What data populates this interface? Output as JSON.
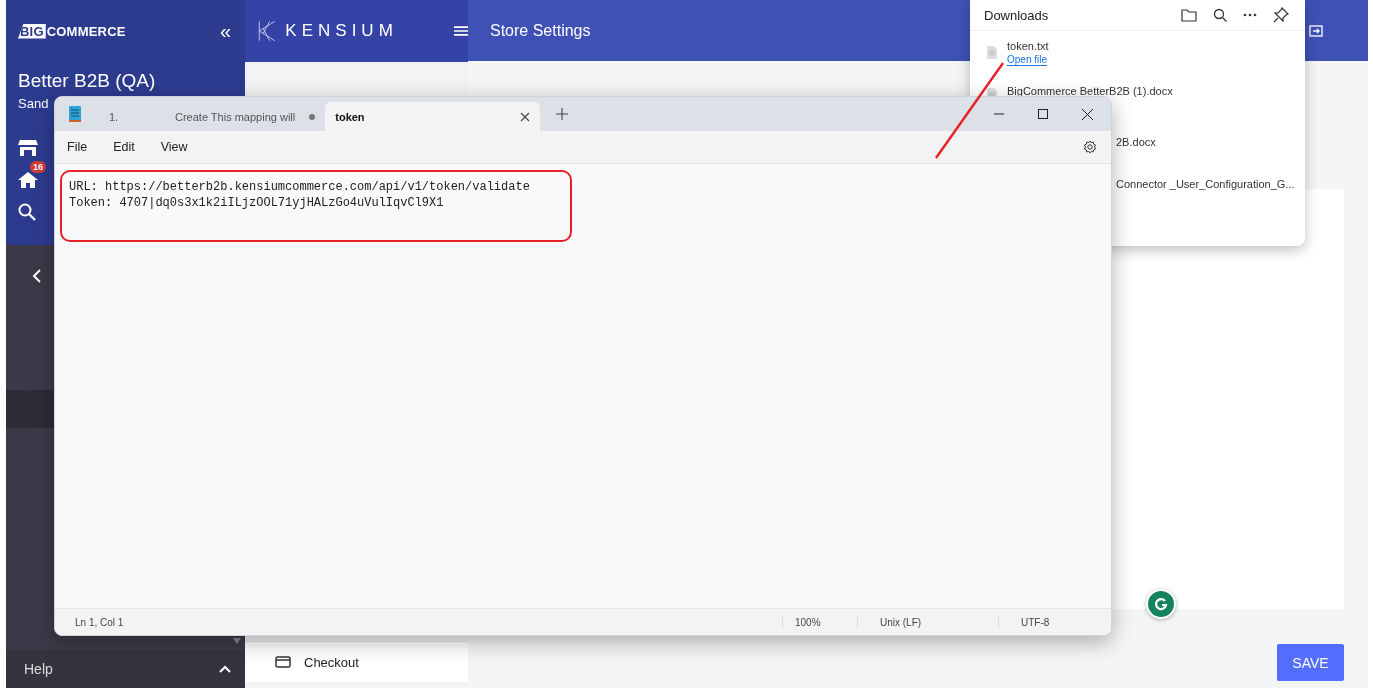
{
  "sidebar": {
    "logo_mark": "BIG",
    "logo_text": "COMMERCE",
    "collapse": "«",
    "store_name": "Better B2B (QA)",
    "store_sub": "Sand",
    "notification_count": "16",
    "help": "Help"
  },
  "kensium": {
    "logo": "KENSIUM",
    "nav": [
      {
        "label": "Checkout"
      }
    ]
  },
  "header": {
    "title": "Store Settings"
  },
  "save": "SAVE",
  "notepad": {
    "tabs": [
      {
        "label": "1.",
        "selected": false,
        "modified": false
      },
      {
        "label": "Create This mapping will",
        "selected": false,
        "modified": true
      },
      {
        "label": "token",
        "selected": true,
        "modified": false
      }
    ],
    "menu": [
      "File",
      "Edit",
      "View"
    ],
    "lines": [
      "URL: https://betterb2b.kensiumcommerce.com/api/v1/token/validate",
      "Token: 4707|dq0s3x1k2iILjzOOL71yjHALzGo4uVulIqvCl9X1"
    ],
    "status": [
      "Ln 1, Col 1",
      "100%",
      "Unix (LF)",
      "UTF-8"
    ]
  },
  "downloads": {
    "title": "Downloads",
    "items": [
      {
        "kind": "file",
        "name": "token.txt",
        "action": "Open file"
      },
      {
        "kind": "file",
        "name": "BigCommerce BetterB2B (1).docx"
      },
      {
        "kind": "covered",
        "name": "2B.docx"
      },
      {
        "kind": "covered",
        "name": "Connector _User_Configuration_G..."
      }
    ]
  }
}
